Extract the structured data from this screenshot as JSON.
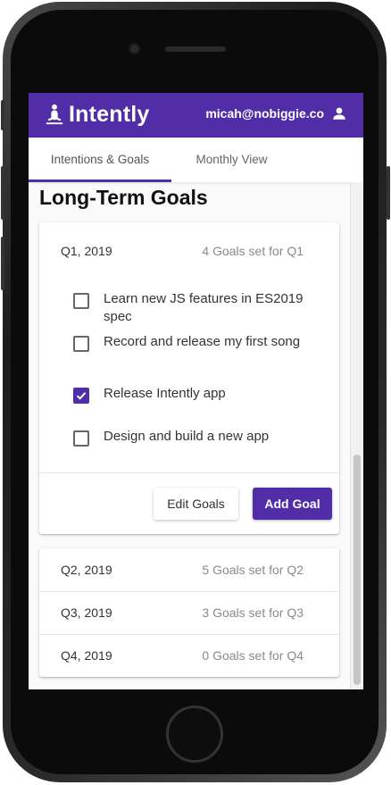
{
  "app": {
    "name": "Intently",
    "brand_icon": "meditation-icon",
    "user_email": "micah@nobiggie.co",
    "user_icon": "person-icon",
    "accent": "#512da8"
  },
  "tabs": [
    {
      "label": "Intentions & Goals",
      "active": true
    },
    {
      "label": "Monthly View",
      "active": false
    }
  ],
  "section_title": "Long-Term Goals",
  "quarters": [
    {
      "name": "Q1, 2019",
      "count": "4 Goals set for Q1",
      "expanded": true,
      "goals": [
        {
          "text": "Learn new JS features in ES2019 spec",
          "checked": false
        },
        {
          "text": "Record and release my first song",
          "checked": false
        },
        {
          "text": "Release Intently app",
          "checked": true
        },
        {
          "text": "Design and build a new app",
          "checked": false
        }
      ],
      "actions": {
        "edit": "Edit Goals",
        "add": "Add Goal"
      }
    },
    {
      "name": "Q2, 2019",
      "count": "5 Goals set for Q2"
    },
    {
      "name": "Q3, 2019",
      "count": "3 Goals set for Q3"
    },
    {
      "name": "Q4, 2019",
      "count": "0 Goals set for Q4"
    }
  ]
}
